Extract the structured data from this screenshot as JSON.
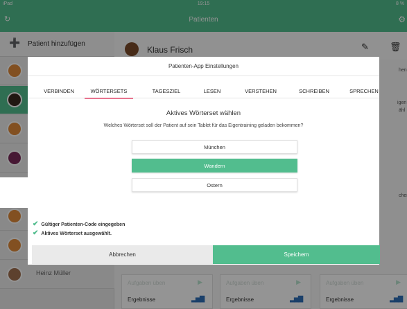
{
  "statusbar": {
    "device": "iPad",
    "time": "19:15",
    "battery": "8 %"
  },
  "appbar": {
    "title": "Patienten"
  },
  "sidebar": {
    "add_patient_label": "Patient hinzufügen",
    "last_patient_name": "Heinz Müller"
  },
  "patient": {
    "name": "Klaus Frisch"
  },
  "side_snippets": [
    "hen",
    "igen",
    "ähl",
    "chen"
  ],
  "cards": [
    {
      "task": "Aufgaben üben",
      "results": "Ergebnisse"
    },
    {
      "task": "Aufgaben üben",
      "results": "Ergebnisse"
    },
    {
      "task": "Aufgaben üben",
      "results": "Ergebnisse"
    }
  ],
  "modal": {
    "title": "Patienten-App Einstellungen",
    "tabs": [
      "VERBINDEN",
      "WÖRTERSETS",
      "TAGESZIEL",
      "LESEN",
      "VERSTEHEN",
      "SCHREIBEN",
      "SPRECHEN"
    ],
    "active_tab": "WÖRTERSETS",
    "section_title": "Aktives Wörterset wählen",
    "section_desc": "Welches Wörterset soll der Patient auf sein Tablet für das Eigentraining geladen bekommen?",
    "options": [
      "München",
      "Wandern",
      "Ostern"
    ],
    "selected_option": "Wandern",
    "status": [
      "Gültiger Patienten-Code eingegeben",
      "Aktives Wörterset ausgewählt."
    ],
    "cancel_label": "Abbrechen",
    "save_label": "Speichern"
  },
  "colors": {
    "accent": "#52bd8e",
    "tab_underline": "#e8738e"
  }
}
